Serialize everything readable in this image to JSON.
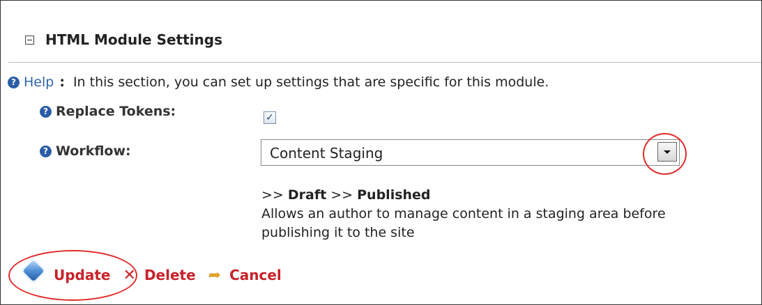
{
  "section": {
    "title": "HTML Module Settings"
  },
  "help": {
    "link_label": "Help",
    "colon": ":",
    "text": "In this section, you can set up settings that are specific for this module."
  },
  "fields": {
    "replace_tokens": {
      "label": "Replace Tokens:",
      "checked": true
    },
    "workflow": {
      "label": "Workflow:",
      "selected_value": "Content Staging",
      "steps_prefix_1": ">> ",
      "step_1": "Draft",
      "steps_prefix_2": " >> ",
      "step_2": "Published",
      "description": "Allows an author to manage content in a staging area before publishing it to the site"
    }
  },
  "actions": {
    "update_label": "Update",
    "delete_label": "Delete",
    "cancel_label": "Cancel"
  },
  "icons": {
    "collapse": "minus-box-icon",
    "help": "question-circle-icon",
    "update": "update-diamond-icon",
    "delete": "x-icon",
    "cancel": "back-arrow-icon",
    "dropdown": "chevron-down-icon"
  },
  "colors": {
    "link_blue": "#2f65ac",
    "action_red": "#c8222a",
    "highlight_circle": "#e12b2b"
  }
}
